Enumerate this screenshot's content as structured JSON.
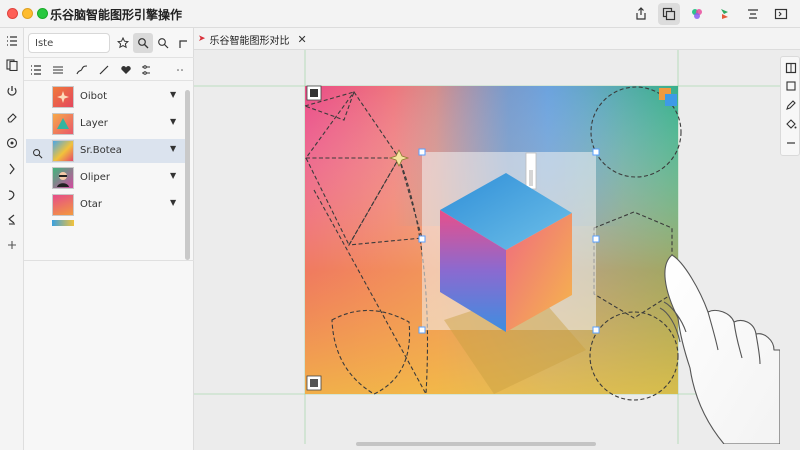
{
  "app": {
    "title": "乐谷脑智能图形引擎操作"
  },
  "toolbar_icons": [
    "share-icon",
    "duplicate-icon",
    "color-icon",
    "layers-icon",
    "align-icon",
    "sidebar-icon"
  ],
  "panel": {
    "search": {
      "value": "Iste",
      "placeholder": ""
    },
    "layers": [
      {
        "label": "Oibot",
        "thumb": "star"
      },
      {
        "label": "Layer",
        "thumb": "triangle"
      },
      {
        "label": "Sr.Botea",
        "thumb": "abstract"
      },
      {
        "label": "Oliper",
        "thumb": "portrait"
      },
      {
        "label": "Otar",
        "thumb": "gradient"
      }
    ]
  },
  "document": {
    "tab_label": "乐谷智能图形对比"
  },
  "colors": {
    "accent": "#5aa0ff",
    "selection": "#dbe3ee"
  }
}
